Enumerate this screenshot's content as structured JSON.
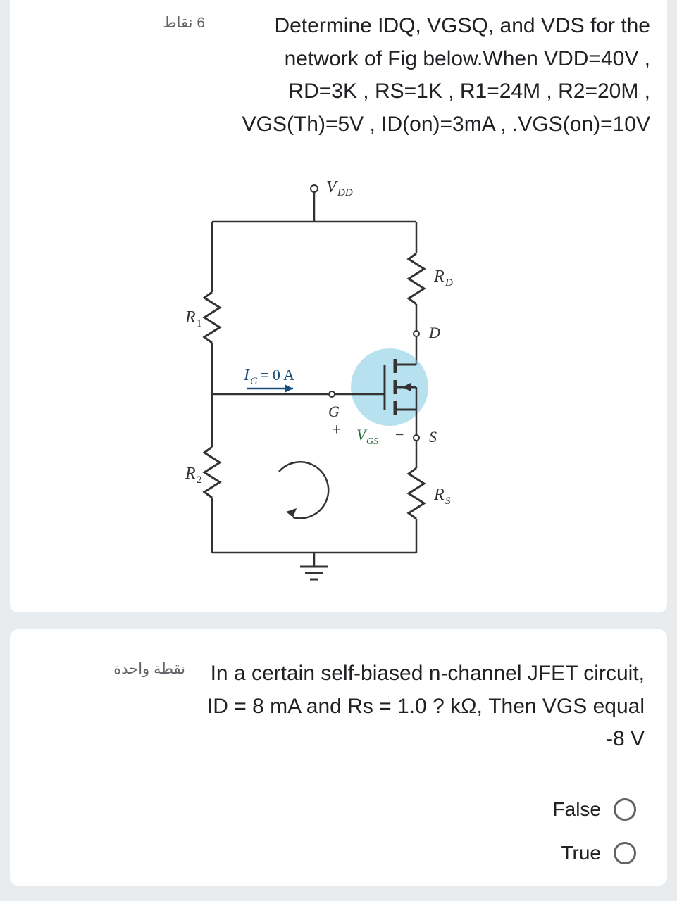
{
  "q1": {
    "points": "6 نقاط",
    "text": "Determine IDQ, VGSQ, and VDS for the network of Fig below.When VDD=40V , RD=3K , RS=1K , R1=24M , R2=20M , VGS(Th)=5V , ID(on)=3mA , .VGS(on)=10V",
    "diagram": {
      "vdd": "V_DD",
      "r1": "R₁",
      "r2": "R₂",
      "rd": "R_D",
      "rs": "R_S",
      "d": "D",
      "g": "G",
      "s": "S",
      "ig": "I_G = 0 A",
      "vgs": "V_GS",
      "plus": "+",
      "minus": "−"
    }
  },
  "q2": {
    "points": "نقطة واحدة",
    "text": "In a certain self-biased n-channel JFET circuit, ID = 8 mA and Rs = 1.0 ? kΩ, Then VGS equal -8 V",
    "options": {
      "false": "False",
      "true": "True"
    }
  }
}
